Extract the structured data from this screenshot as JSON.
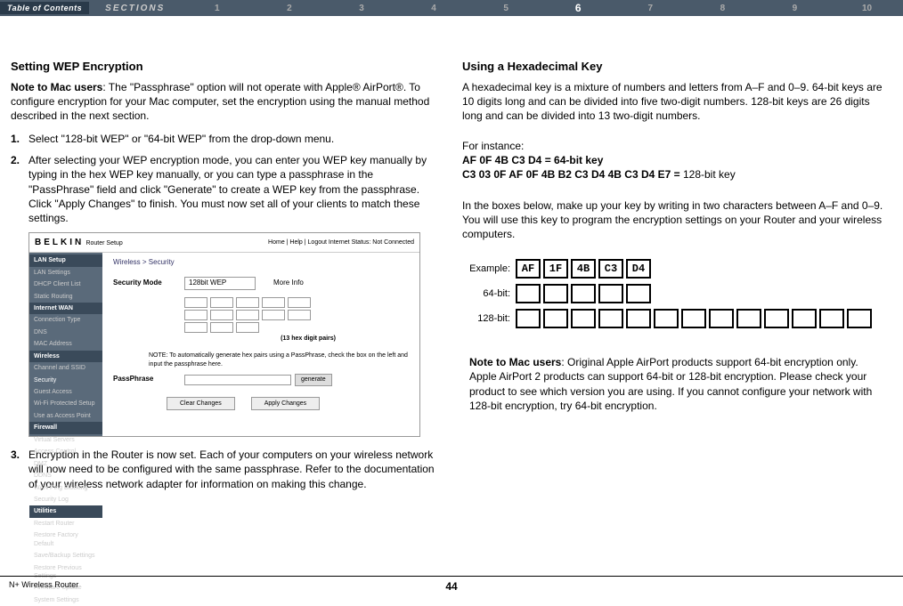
{
  "topbar": {
    "toc": "Table of Contents",
    "sections_label": "SECTIONS",
    "sections": [
      "1",
      "2",
      "3",
      "4",
      "5",
      "6",
      "7",
      "8",
      "9",
      "10"
    ],
    "active": "6"
  },
  "left": {
    "h1": "Setting WEP Encryption",
    "note_bold": "Note to Mac users",
    "note_text": ": The \"Passphrase\" option will not operate with Apple® AirPort®. To configure encryption for your Mac computer, set the encryption using the manual method described in the next section.",
    "items": [
      "Select \"128-bit WEP\" or \"64-bit WEP\" from the drop-down menu.",
      "After selecting your WEP encryption mode, you can enter you WEP key manually by typing in the hex WEP key manually, or you can type a passphrase in the \"PassPhrase\" field and click \"Generate\" to create a WEP key from the passphrase. Click \"Apply Changes\" to finish. You must now set all of your clients to match these settings."
    ],
    "item3": "Encryption in the Router is now set. Each of your computers on your wireless network will now need to be configured with the same passphrase. Refer to the documentation of your wireless network adapter for information on making this change.",
    "ss": {
      "logo": "BELKIN",
      "router_setup": "Router Setup",
      "top_right": "Home | Help | Logout    Internet Status: Not Connected",
      "side": {
        "lan": "LAN Setup",
        "lan_items": [
          "LAN Settings",
          "DHCP Client List",
          "Static Routing"
        ],
        "wan": "Internet WAN",
        "wan_items": [
          "Connection Type",
          "DNS",
          "MAC Address"
        ],
        "wireless": "Wireless",
        "wireless_items": [
          "Channel and SSID",
          "Security",
          "Guest Access",
          "Wi-Fi Protected Setup",
          "Use as Access Point"
        ],
        "firewall": "Firewall",
        "fw_items": [
          "Virtual Servers",
          "Access Control",
          "DMZ",
          "DDNS",
          "WAN Ping Blocking",
          "Security Log"
        ],
        "utilities": "Utilities",
        "util_items": [
          "Restart Router",
          "Restore Factory Default",
          "Save/Backup Settings",
          "Restore Previous Settings",
          "Firmware Update",
          "System Settings"
        ]
      },
      "crumb": "Wireless > Security",
      "sec_mode_label": "Security Mode",
      "sec_mode_value": "128bit WEP",
      "more_info": "More Info",
      "hex_caption": "(13 hex digit pairs)",
      "note_label": "NOTE:",
      "pp_note": "To automatically generate hex pairs using a PassPhrase, check the box on the left and input the passphrase here.",
      "pp_label": "PassPhrase",
      "generate": "generate",
      "clear": "Clear Changes",
      "apply": "Apply Changes"
    }
  },
  "right": {
    "h1": "Using a Hexadecimal Key",
    "p1": "A hexadecimal key is a mixture of numbers and letters from A–F and 0–9. 64-bit keys are 10 digits long and can be divided into five two-digit numbers. 128-bit keys are 26 digits long and can be divided into 13 two-digit numbers.",
    "for_instance": "For instance:",
    "k64_bold": "AF 0F 4B C3 D4 = 64-bit key",
    "k128_bold": "C3 03 0F AF 0F 4B B2 C3 D4 4B C3 D4 E7 =",
    "k128_rest": " 128-bit key",
    "p2": "In the boxes below, make up your key by writing in two characters between A–F and 0–9. You will use this key to program the encryption settings on your Router and your wireless computers.",
    "example_label": "Example:",
    "bit64_label": "64-bit:",
    "bit128_label": "128-bit:",
    "example_cells": [
      "AF",
      "1F",
      "4B",
      "C3",
      "D4"
    ],
    "note2_bold": "Note to Mac users",
    "note2_text": ": Original Apple AirPort products support 64-bit encryption only. Apple AirPort 2 products can support 64-bit or 128-bit encryption. Please check your product to see which version you are using. If you cannot configure your network with 128-bit encryption, try 64-bit encryption."
  },
  "footer": {
    "left": "N+ Wireless Router",
    "page": "44"
  }
}
